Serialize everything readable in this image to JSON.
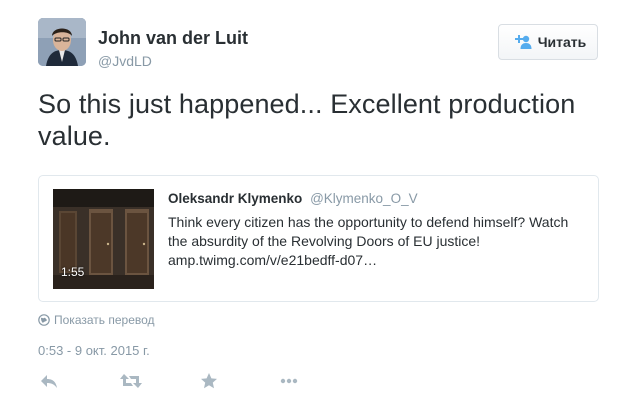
{
  "author": {
    "name": "John van der Luit",
    "handle": "@JvdLD",
    "avatar_icon": "user-photo"
  },
  "follow_button": {
    "label": "Читать",
    "icon": "follow-user-icon",
    "accent_color": "#55acee"
  },
  "tweet": {
    "text": "So this just happened... Excellent production value."
  },
  "quoted_card": {
    "author_name": "Oleksandr Klymenko",
    "author_handle": "@Klymenko_O_V",
    "text": "Think every citizen has the opportunity to defend himself? Watch the absurdity of the Revolving Doors of EU justice!",
    "link": "amp.twimg.com/v/e21bedff-d07…",
    "video_duration": "1:55"
  },
  "translate_link": "Показать перевод",
  "timestamp": "0:53 - 9 окт. 2015 г.",
  "actions": [
    "reply-icon",
    "retweet-icon",
    "favorite-star-icon",
    "more-dots-icon"
  ]
}
